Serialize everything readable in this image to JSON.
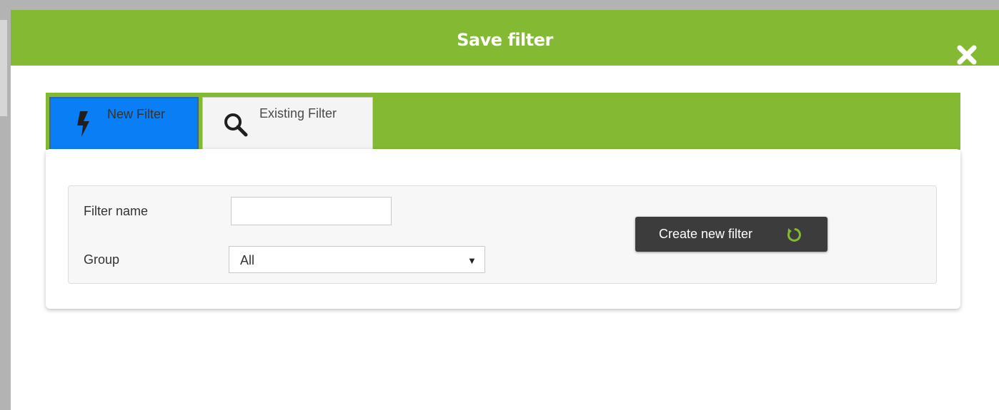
{
  "dialog": {
    "title": "Save filter",
    "close_icon": "close-x-icon"
  },
  "tabs": [
    {
      "label": "New Filter",
      "icon": "lightning-icon",
      "active": true
    },
    {
      "label": "Existing Filter",
      "icon": "search-icon",
      "active": false
    }
  ],
  "form": {
    "filter_name_label": "Filter name",
    "filter_name_value": "",
    "group_label": "Group",
    "group_selected": "All"
  },
  "actions": {
    "create_label": "Create new filter",
    "create_icon": "refresh-icon"
  },
  "colors": {
    "header_green": "#84b934",
    "active_tab_blue": "#0a7ff5",
    "button_dark": "#3c3c3c",
    "icon_green": "#84b934"
  }
}
